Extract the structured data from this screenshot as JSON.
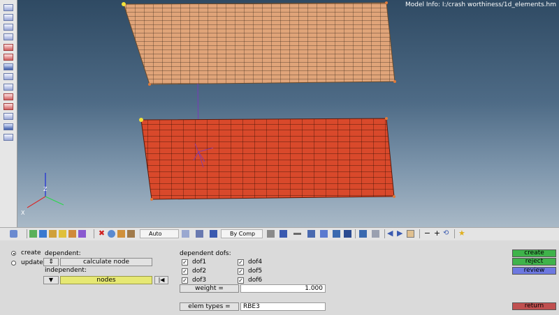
{
  "viewport": {
    "model_info": "Model Info: I:/crash worthiness/1d_elements.hm",
    "axes": {
      "z": "Z",
      "x": "X"
    }
  },
  "toolbar": {
    "display_mode": "Auto",
    "color_mode": "By Comp"
  },
  "panel": {
    "mode_create": "create",
    "mode_update": "update",
    "dependent_label": "dependent:",
    "calculate_node_label": "calculate node",
    "independent_label": "independent:",
    "nodes_label": "nodes",
    "dofs_header": "dependent dofs:",
    "dofs": [
      "dof1",
      "dof2",
      "dof3",
      "dof4",
      "dof5",
      "dof6"
    ],
    "weight_label": "weight =",
    "weight_value": "1.000",
    "elem_types_label": "elem types =",
    "elem_types_value": "RBE3",
    "buttons": {
      "create": "create",
      "reject": "reject",
      "review": "review",
      "return": "return"
    }
  },
  "colors": {
    "upper_mesh": "#e0a479",
    "lower_mesh": "#d9492b",
    "create_button": "#3fb34a",
    "review_button": "#6d78e0",
    "return_button": "#c05050",
    "nodes_field": "#e6e873"
  }
}
